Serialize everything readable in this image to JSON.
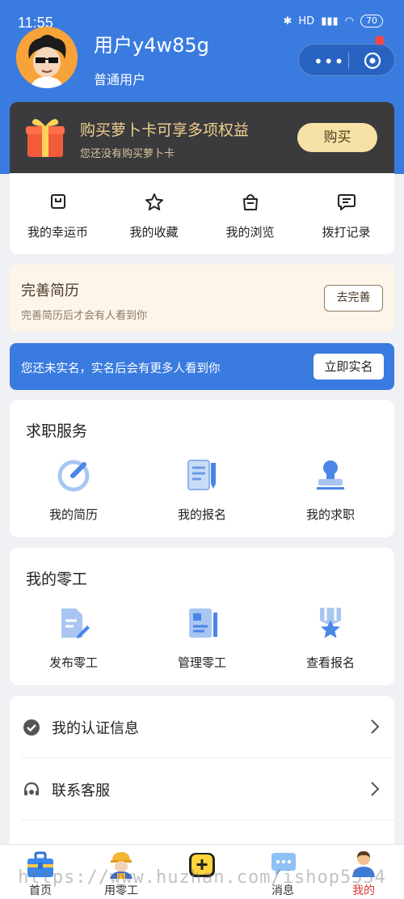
{
  "status_bar": {
    "time": "11:55",
    "signal": "HD",
    "battery": "70"
  },
  "profile": {
    "username": "用户y4w85g",
    "user_type": "普通用户"
  },
  "capsule": {
    "more": "•••"
  },
  "vip": {
    "title": "购买萝卜卡可享多项权益",
    "subtitle": "您还没有购买萝卜卡",
    "button": "购买"
  },
  "quick_actions": [
    {
      "label": "我的幸运币",
      "icon": "coin-icon"
    },
    {
      "label": "我的收藏",
      "icon": "star-icon"
    },
    {
      "label": "我的浏览",
      "icon": "bag-icon"
    },
    {
      "label": "拨打记录",
      "icon": "message-icon"
    }
  ],
  "resume_banner": {
    "title": "完善简历",
    "subtitle": "完善简历后才会有人看到你",
    "button": "去完善"
  },
  "realname_banner": {
    "text": "您还未实名，实名后会有更多人看到你",
    "button": "立即实名"
  },
  "job_services": {
    "title": "求职服务",
    "items": [
      {
        "label": "我的简历",
        "icon": "resume-icon"
      },
      {
        "label": "我的报名",
        "icon": "signup-icon"
      },
      {
        "label": "我的求职",
        "icon": "stamp-icon"
      }
    ]
  },
  "gig_work": {
    "title": "我的零工",
    "items": [
      {
        "label": "发布零工",
        "icon": "publish-icon"
      },
      {
        "label": "管理零工",
        "icon": "manage-icon"
      },
      {
        "label": "查看报名",
        "icon": "medal-icon"
      }
    ]
  },
  "menu": [
    {
      "label": "我的认证信息",
      "icon": "check-circle-icon"
    },
    {
      "label": "联系客服",
      "icon": "headset-icon"
    }
  ],
  "tabbar": [
    {
      "label": "首页",
      "icon": "toolbox-icon"
    },
    {
      "label": "用零工",
      "icon": "worker-icon"
    },
    {
      "label": "",
      "icon": "add-icon"
    },
    {
      "label": "消息",
      "icon": "chat-icon"
    },
    {
      "label": "我的",
      "icon": "profile-icon"
    }
  ],
  "watermark": "https://www.huzhan.com/ishop5534",
  "colors": {
    "primary": "#3a7be0",
    "vip_bg": "#3b3b3d",
    "vip_gold": "#f0cf8c",
    "active_tab": "#d63a2e"
  }
}
